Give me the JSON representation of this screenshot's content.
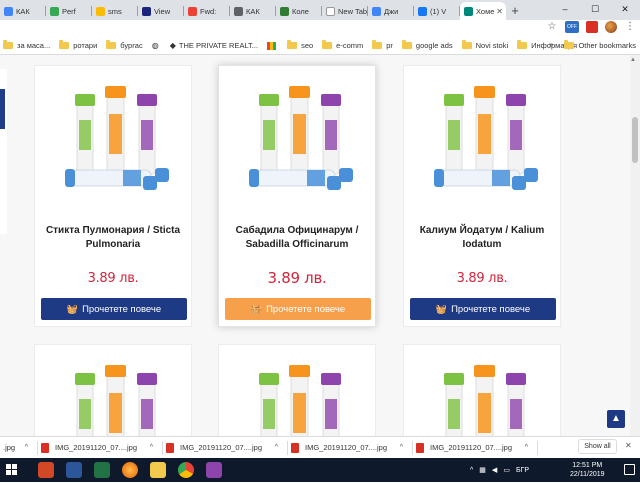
{
  "browser": {
    "tabs": [
      {
        "label": "КАК",
        "color": "#4285f4"
      },
      {
        "label": "Perf",
        "color": "#34a853"
      },
      {
        "label": "sms",
        "color": "#fbbc05"
      },
      {
        "label": "View",
        "color": "#1a237e"
      },
      {
        "label": "Fwd:",
        "color": "#ea4335"
      },
      {
        "label": "КАК",
        "color": "#5f6368"
      },
      {
        "label": "Коле",
        "color": "#2e7d32"
      },
      {
        "label": "New Tab",
        "color": "#ffffff"
      },
      {
        "label": "Джи",
        "color": "#4285f4"
      },
      {
        "label": "(1) V",
        "color": "#1877f2"
      },
      {
        "label": "Хоме",
        "color": "#00897b"
      }
    ],
    "new_tab_label": "+",
    "window_controls": {
      "minimize": "–",
      "maximize": "☐",
      "close": "✕"
    },
    "toolbar_icons": [
      "star-icon",
      "extension-off-icon",
      "extension-red-icon",
      "profile-avatar",
      "menu-icon"
    ],
    "bookmarks": [
      {
        "label": "за маса..."
      },
      {
        "label": "ротари"
      },
      {
        "label": "бургас"
      },
      {
        "label": ""
      },
      {
        "label": "THE PRIVATE REALT..."
      },
      {
        "label": ""
      },
      {
        "label": "seo"
      },
      {
        "label": "e-comm"
      },
      {
        "label": "pr"
      },
      {
        "label": "google ads"
      },
      {
        "label": "Novi stoki"
      },
      {
        "label": "Информация"
      }
    ],
    "bookmarks_more": "»",
    "other_bookmarks": "Other bookmarks"
  },
  "products": [
    {
      "title": "Стикта Пулмонария / Sticta Pulmonaria",
      "price": "3.89 лв.",
      "button": "Прочетете повече",
      "hover": false
    },
    {
      "title": "Сабадила Официнарум / Sabadilla Officinarum",
      "price": "3.89 лв.",
      "button": "Прочетете повече",
      "hover": true
    },
    {
      "title": "Калиум Йодатум / Kalium Iodatum",
      "price": "3.89 лв.",
      "button": "Прочетете повече",
      "hover": false
    }
  ],
  "colors": {
    "price": "#d1263e",
    "button": "#1f3a85",
    "button_hover": "#f7a04c"
  },
  "downloads": {
    "items": [
      {
        "label": ".jpg"
      },
      {
        "label": "IMG_20191120_07....jpg"
      },
      {
        "label": "IMG_20191120_07....jpg"
      },
      {
        "label": "IMG_20191120_07....jpg"
      },
      {
        "label": "IMG_20191120_07....jpg"
      }
    ],
    "show_all": "Show all",
    "close": "✕"
  },
  "taskbar": {
    "language": "БГР",
    "time": "12:51 PM",
    "date": "22/11/2019",
    "tray_up": "^"
  },
  "back_to_top": "▲"
}
